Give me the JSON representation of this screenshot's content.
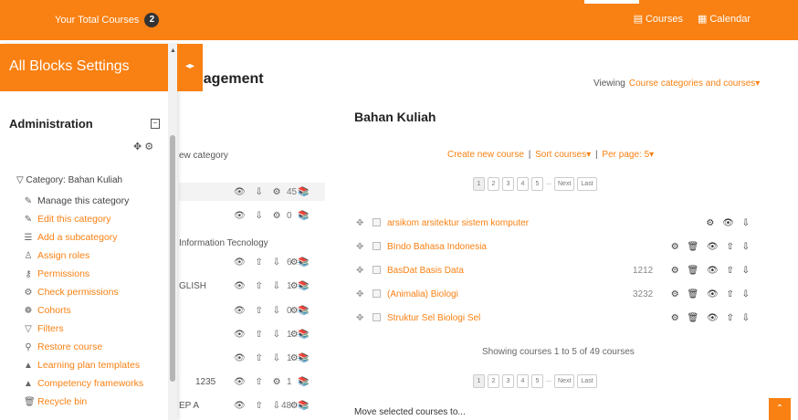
{
  "topbar": {
    "total_label": "Your Total Courses",
    "total_count": "2",
    "nav_courses": "Courses",
    "nav_calendar": "Calendar"
  },
  "drawer": {
    "title": "All Blocks Settings",
    "toggle_icon": "chevron-double-icon",
    "admin_title": "Administration",
    "category_label": "Category: Bahan Kuliah",
    "menu": [
      {
        "label": "Manage this category",
        "icon": "pencil-icon",
        "glyph": "✎"
      },
      {
        "label": "Edit this category",
        "icon": "pencil-icon",
        "glyph": "✎"
      },
      {
        "label": "Add a subcategory",
        "icon": "list-add-icon",
        "glyph": "☰"
      },
      {
        "label": "Assign roles",
        "icon": "user-icon",
        "glyph": "♙"
      },
      {
        "label": "Permissions",
        "icon": "key-icon",
        "glyph": "⚷"
      },
      {
        "label": "Check permissions",
        "icon": "check-permissions-icon",
        "glyph": "⚙"
      },
      {
        "label": "Cohorts",
        "icon": "users-icon",
        "glyph": "❁"
      },
      {
        "label": "Filters",
        "icon": "filter-icon",
        "glyph": "▽"
      },
      {
        "label": "Restore course",
        "icon": "restore-icon",
        "glyph": "⚲"
      },
      {
        "label": "Learning plan templates",
        "icon": "template-icon",
        "glyph": "▲"
      },
      {
        "label": "Competency frameworks",
        "icon": "framework-icon",
        "glyph": "▲"
      },
      {
        "label": "Recycle bin",
        "icon": "trash-icon",
        "glyph": "🗑"
      }
    ]
  },
  "main": {
    "title_fragment": "nagement",
    "viewing_label": "Viewing",
    "viewing_value": "Course categories and courses",
    "left_rows": [
      {
        "text": "ew category",
        "link": true,
        "icons": "",
        "count": "",
        "book": ""
      },
      {
        "text": "",
        "link": false,
        "icons": "👁 ⇩ ⚙",
        "count": "45",
        "book": "📚"
      },
      {
        "text": "",
        "link": false,
        "icons": "👁 ⇩ ⚙",
        "count": "0",
        "book": "📚"
      },
      {
        "text": "Information Tecnology",
        "link": true,
        "icons": "",
        "count": "",
        "book": ""
      },
      {
        "text": "",
        "link": false,
        "icons": "👁 ⇧ ⇩ ⚙",
        "count": "6",
        "book": "📚"
      },
      {
        "text": "GLISH",
        "link": false,
        "icons": "👁 ⇧ ⇩ ⚙",
        "count": "1",
        "book": "📚"
      },
      {
        "text": "",
        "link": false,
        "icons": "👁 ⇧ ⇩ ⚙",
        "count": "0",
        "book": "📚"
      },
      {
        "text": "",
        "link": false,
        "icons": "👁 ⇧ ⇩ ⚙",
        "count": "1",
        "book": "📚"
      },
      {
        "text": "",
        "link": false,
        "icons": "👁 ⇧ ⇩ ⚙",
        "count": "1",
        "book": "📚"
      },
      {
        "text": "1235",
        "link": false,
        "icons": "👁 ⇧ ⚙",
        "count": "1",
        "book": "📚"
      },
      {
        "text": "EP A",
        "link": false,
        "icons": "👁 ⇧ ⇩ ⚙",
        "count": "48",
        "book": "📚"
      }
    ],
    "category_title": "Bahan Kuliah",
    "create_course": "Create new course",
    "sort_courses": "Sort courses",
    "per_page": "Per page: 5",
    "pager_top": [
      "1",
      "2",
      "3",
      "4",
      "5",
      "...",
      "Next",
      "Last"
    ],
    "courses": [
      {
        "name": "arsikom arsitektur sistem komputer",
        "id": "",
        "actions": "⚙ 👁 ⇩"
      },
      {
        "name": "BIndo Bahasa Indonesia",
        "id": "",
        "actions": "⚙ 🗑 👁 ⇧ ⇩"
      },
      {
        "name": "BasDat Basis Data",
        "id": "1212",
        "actions": "⚙ 🗑 👁 ⇧ ⇩"
      },
      {
        "name": "(Animalia) Biologi",
        "id": "3232",
        "actions": "⚙ 🗑 👁 ⇧ ⇩"
      },
      {
        "name": "Struktur Sel Biologi Sel",
        "id": "",
        "actions": "⚙ 🗑 👁 ⇧ ⇩"
      }
    ],
    "showing": "Showing courses 1 to 5 of 49 courses",
    "pager_bottom": [
      "1",
      "2",
      "3",
      "4",
      "5",
      "...",
      "Next",
      "Last"
    ],
    "move_selected": "Move selected courses to..."
  },
  "colors": {
    "accent": "#f98012",
    "drawer_bg": "#ffffff"
  }
}
